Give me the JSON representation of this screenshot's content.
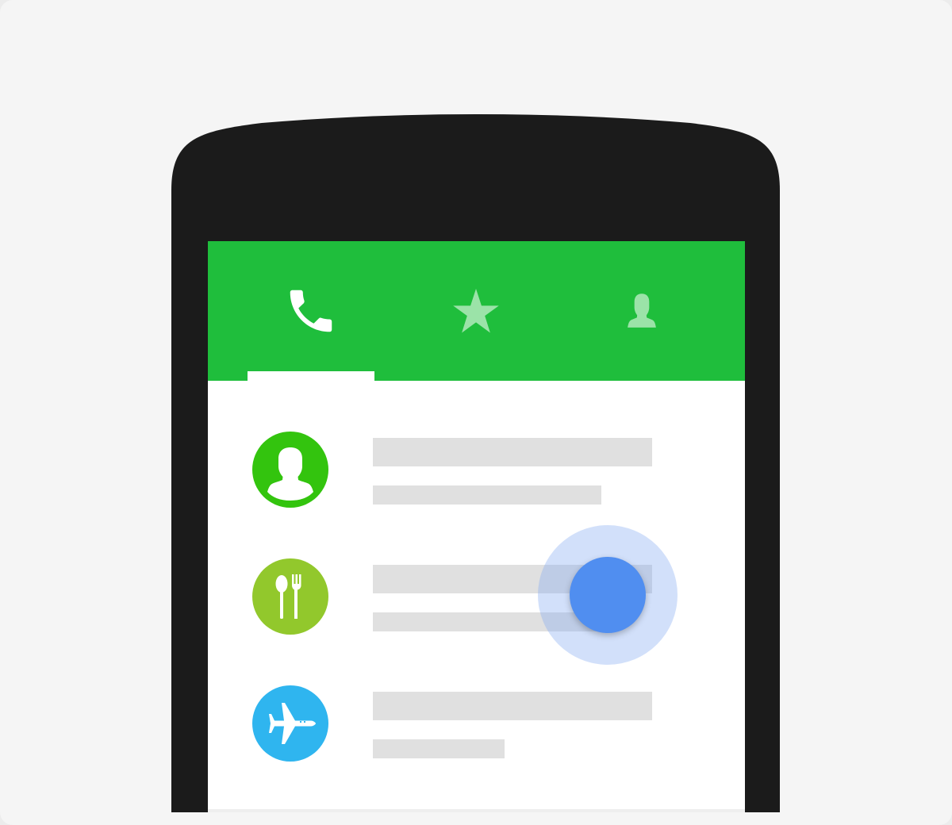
{
  "colors": {
    "background": "#f5f5f5",
    "phone_body": "#1b1b1b",
    "app_bar": "#1fbe3c",
    "placeholder_bar": "#e0e0e0",
    "touch_indicator": "#508ef0"
  },
  "tabs": [
    {
      "icon": "phone-icon",
      "selected": true
    },
    {
      "icon": "star-icon",
      "selected": false
    },
    {
      "icon": "person-icon",
      "selected": false
    }
  ],
  "list_items": [
    {
      "avatar_icon": "person-icon",
      "avatar_color": "#33c40e"
    },
    {
      "avatar_icon": "restaurant-icon",
      "avatar_color": "#92c82c"
    },
    {
      "avatar_icon": "airplane-icon",
      "avatar_color": "#2fb5ef"
    }
  ],
  "touch_indicator": {
    "visible": true
  }
}
